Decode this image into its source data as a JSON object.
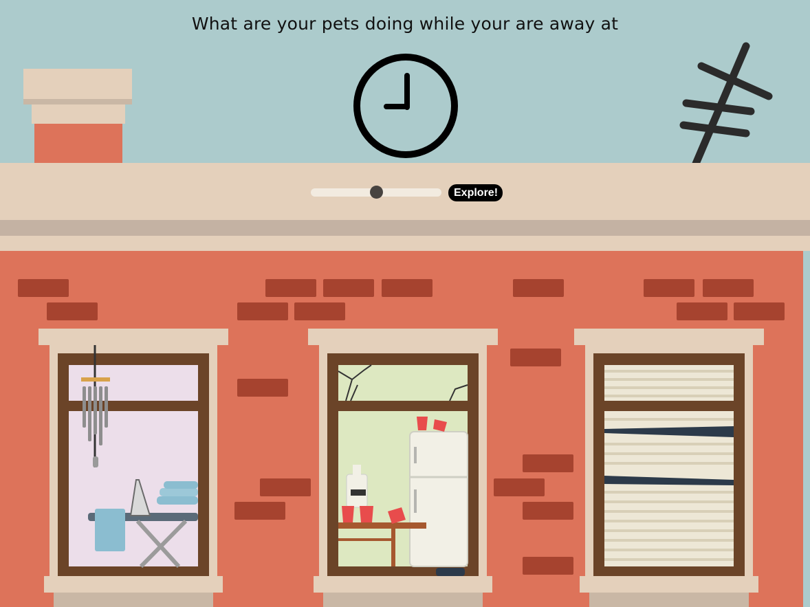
{
  "page": {
    "title": "What are your pets doing while your are away at"
  },
  "clock": {
    "icon": "clock-icon",
    "hour": 9,
    "minute": 0
  },
  "time_slider": {
    "value_fraction": 0.5
  },
  "explore_button": {
    "label": "Explore!"
  },
  "colors": {
    "sky": "#accbcc",
    "brick_wall": "#dd735a",
    "brick": "#a6432f",
    "cornice": "#e4d0bb",
    "window_frame": "#6b4428",
    "button_bg": "#000000"
  },
  "windows": [
    {
      "name": "laundry-room-window",
      "scene": "ironing board, iron, folded towels, wind chime"
    },
    {
      "name": "kitchen-window",
      "scene": "broken glass, refrigerator, red cups, bottle, table"
    },
    {
      "name": "blinds-window",
      "scene": "bent window blinds"
    }
  ]
}
